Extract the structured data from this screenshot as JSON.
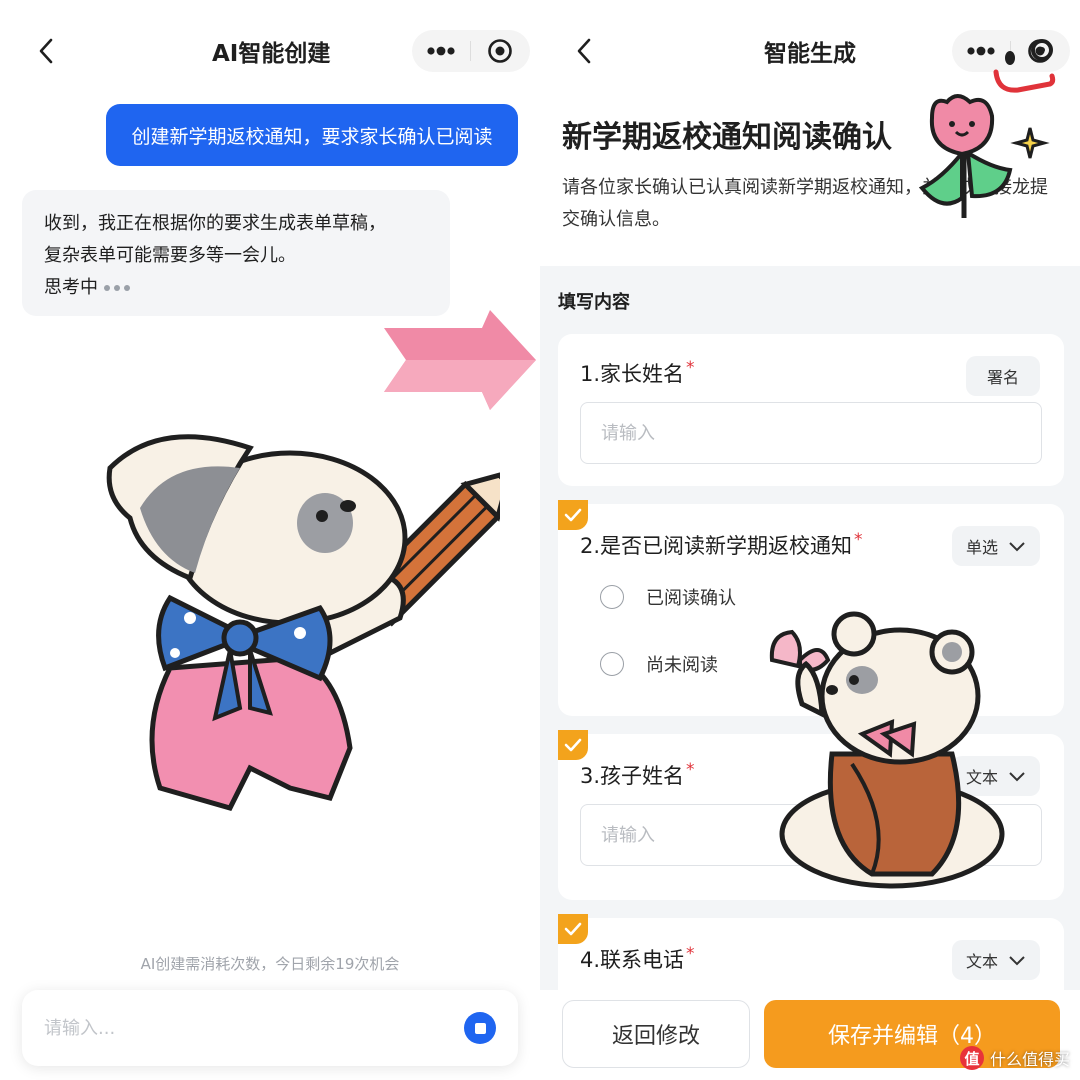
{
  "left": {
    "nav_title": "AI智能创建",
    "user_message": "创建新学期返校通知，要求家长确认已阅读",
    "ai_line1": "收到，我正在根据你的要求生成表单草稿，",
    "ai_line2": "复杂表单可能需要多等一会儿。",
    "ai_thinking": "思考中",
    "quota_notice": "AI创建需消耗次数，今日剩余19次机会",
    "input_placeholder": "请输入..."
  },
  "right": {
    "nav_title": "智能生成",
    "form_title": "新学期返校通知阅读确认",
    "form_desc": "请各位家长确认已认真阅读新学期返校通知，并完成本接龙提交确认信息。",
    "section_label": "填写内容",
    "questions": [
      {
        "title": "1.家长姓名",
        "type_label": "署名",
        "placeholder": "请输入"
      },
      {
        "title": "2.是否已阅读新学期返校通知",
        "type_label": "单选",
        "options": [
          "已阅读确认",
          "尚未阅读"
        ]
      },
      {
        "title": "3.孩子姓名",
        "type_label": "文本",
        "placeholder": "请输入"
      },
      {
        "title": "4.联系电话",
        "type_label": "文本"
      }
    ],
    "required_mark": "*",
    "back_button": "返回修改",
    "save_button": "保存并编辑（4）"
  },
  "watermark": {
    "logo_char": "值",
    "text": "什么值得买"
  },
  "colors": {
    "primary_blue": "#1f65f0",
    "orange": "#f59b1e",
    "badge_orange": "#f3a31c",
    "required_red": "#e0333a",
    "sticker_pink": "#f08aa6"
  }
}
